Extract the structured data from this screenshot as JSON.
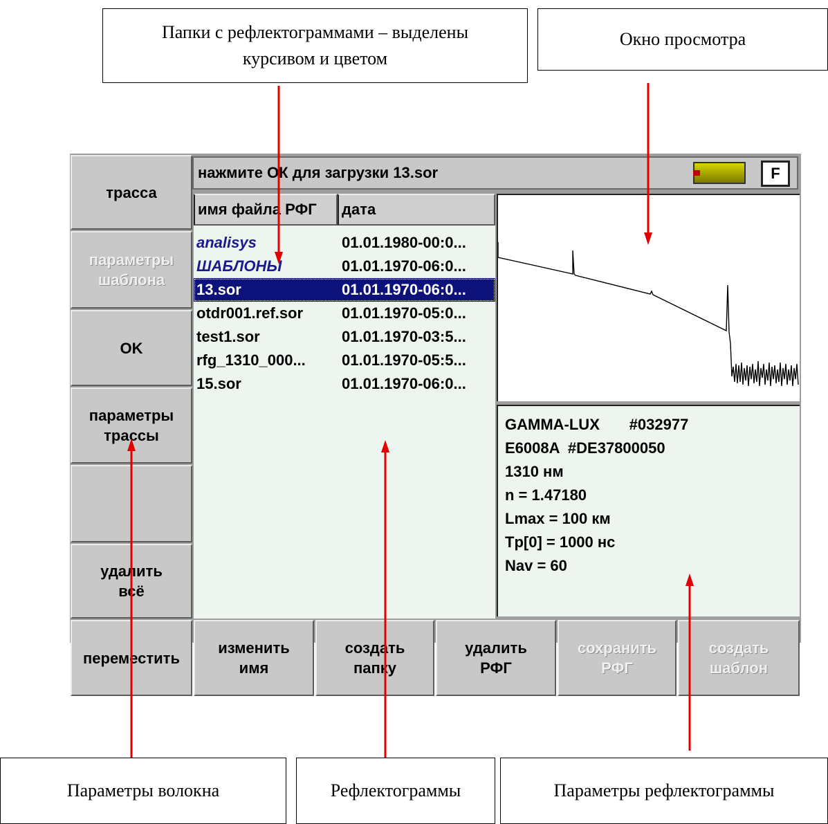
{
  "callouts": {
    "folders": "Папки с рефлектограммами – выделены\nкурсивом и цветом",
    "preview": "Окно просмотра",
    "fiber_params": "Параметры волокна",
    "traces": "Рефлектограммы",
    "trace_params": "Параметры рефлектограммы"
  },
  "status": {
    "message": "нажмите ОК для загрузки 13.sor",
    "f_key": "F"
  },
  "side_buttons": {
    "trace": "трасса",
    "template_params": "параметры\nшаблона",
    "ok": "OK",
    "trace_params": "параметры\nтрассы",
    "empty": "",
    "delete_all": "удалить\nвсё"
  },
  "bottom_buttons": {
    "move": "переместить",
    "rename": "изменить\nимя",
    "create_folder": "создать\nпапку",
    "delete_rfg": "удалить\nРФГ",
    "save_rfg": "сохранить\nРФГ",
    "create_template": "создать\nшаблон"
  },
  "file_list": {
    "col_name": "имя файла РФГ",
    "col_date": "дата",
    "rows": [
      {
        "name": "analisys",
        "date": "01.01.1980-00:0..."
      },
      {
        "name": "ШАБЛОНЫ",
        "date": "01.01.1970-06:0..."
      },
      {
        "name": "13.sor",
        "date": "01.01.1970-06:0..."
      },
      {
        "name": "otdr001.ref.sor",
        "date": "01.01.1970-05:0..."
      },
      {
        "name": "test1.sor",
        "date": "01.01.1970-03:5..."
      },
      {
        "name": "rfg_1310_000...",
        "date": "01.01.1970-05:5..."
      },
      {
        "name": "15.sor",
        "date": "01.01.1970-06:0..."
      }
    ]
  },
  "trace_info": {
    "line1": "GAMMA-LUX       #032977",
    "line2": "E6008A  #DE37800050",
    "line3": "1310 нм",
    "line4": "n = 1.47180",
    "line5": "Lmax = 100 км",
    "line6": "Tp[0] = 1000 нс",
    "line7": "Nav = 60"
  },
  "colors": {
    "selection": "#0d127a",
    "folder_text": "#1a1a8c",
    "arrow": "#e00000",
    "panel_bg": "#eef4ee"
  }
}
